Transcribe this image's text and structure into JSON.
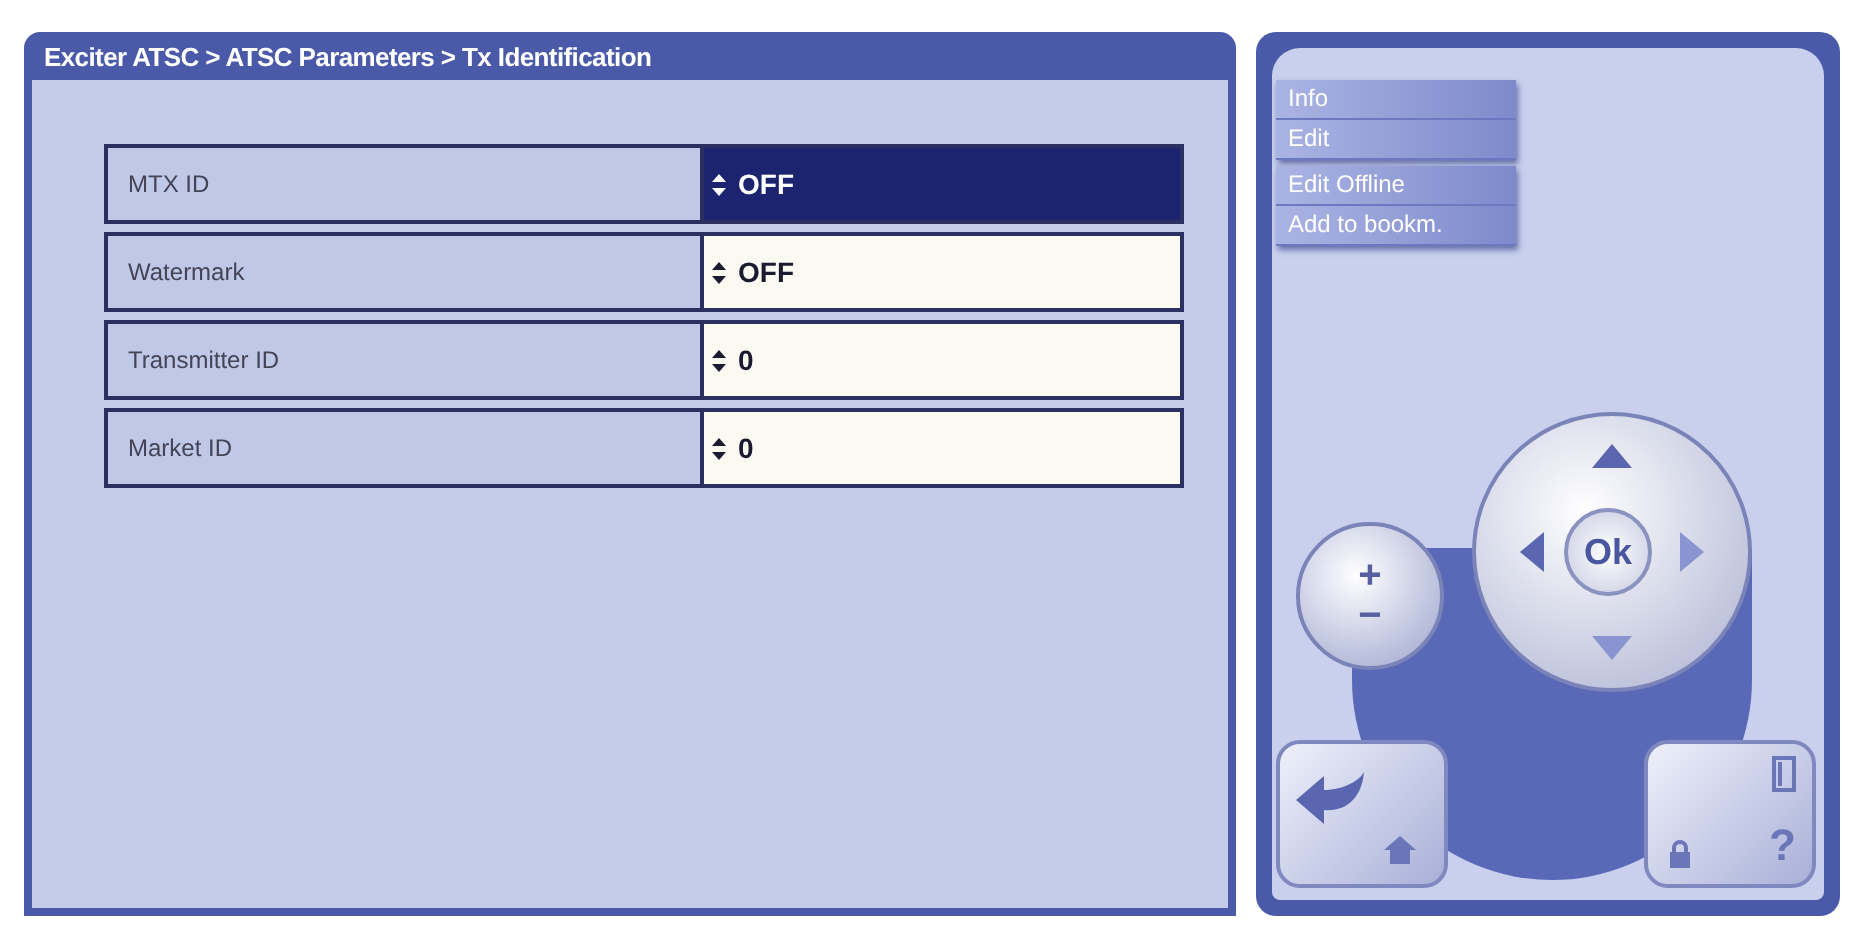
{
  "breadcrumb": "Exciter ATSC > ATSC Parameters > Tx Identification",
  "parameters": [
    {
      "label": "MTX ID",
      "value": "OFF",
      "selected": true
    },
    {
      "label": "Watermark",
      "value": "OFF",
      "selected": false
    },
    {
      "label": "Transmitter ID",
      "value": "0",
      "selected": false
    },
    {
      "label": "Market ID",
      "value": "0",
      "selected": false
    }
  ],
  "menu_groups": [
    {
      "items": [
        {
          "label": "Info"
        },
        {
          "label": "Edit"
        }
      ]
    },
    {
      "items": [
        {
          "label": "Edit Offline"
        },
        {
          "label": "Add to bookm."
        }
      ]
    }
  ],
  "keypad": {
    "plus": "+",
    "minus": "−",
    "ok": "Ok",
    "help": "?"
  }
}
